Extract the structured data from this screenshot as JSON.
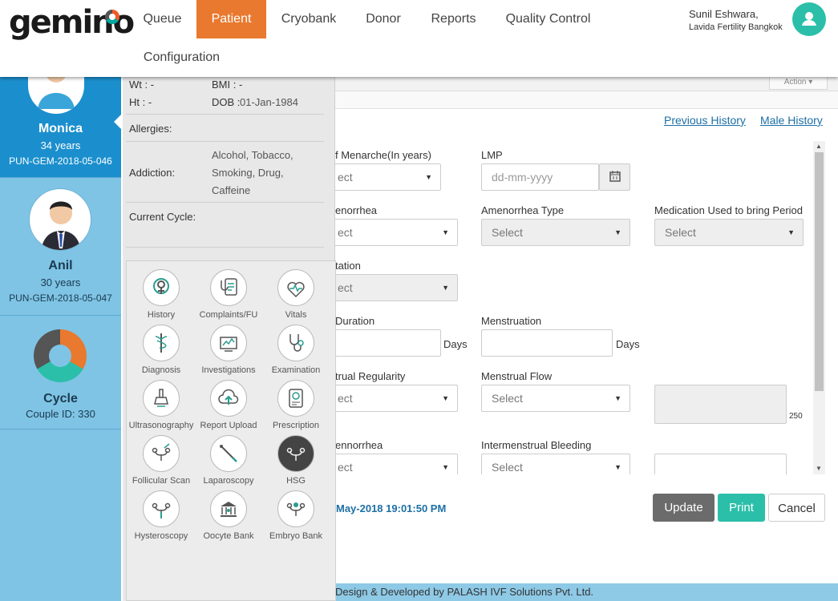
{
  "header": {
    "logo": "gemino",
    "nav": [
      "Queue",
      "Patient",
      "Cryobank",
      "Donor",
      "Reports",
      "Quality Control"
    ],
    "nav2": "Configuration",
    "active_nav": "Patient",
    "user_name": "Sunil Eshwara,",
    "user_org": "Lavida Fertility Bangkok"
  },
  "patients": [
    {
      "name": "Monica",
      "age": "34 years",
      "id": "PUN-GEM-2018-05-046"
    },
    {
      "name": "Anil",
      "age": "30 years",
      "id": "PUN-GEM-2018-05-047"
    }
  ],
  "cycle": {
    "title": "Cycle",
    "couple_id": "Couple ID: 330"
  },
  "info": {
    "wt_label": "Wt : -",
    "bmi_label": "BMI : -",
    "ht_label": "Ht : -",
    "dob_label": "DOB :",
    "dob_value": "01-Jan-1984",
    "allergies_label": "Allergies:",
    "addiction_label": "Addiction:",
    "addiction_lines": [
      "Alcohol, Tobacco,",
      "Smoking, Drug,",
      "Caffeine"
    ],
    "current_cycle_label": "Current Cycle:"
  },
  "modules": [
    {
      "label": "History",
      "icon": "history-icon"
    },
    {
      "label": "Complaints/FU",
      "icon": "complaints-icon"
    },
    {
      "label": "Vitals",
      "icon": "vitals-icon"
    },
    {
      "label": "Diagnosis",
      "icon": "diagnosis-icon"
    },
    {
      "label": "Investigations",
      "icon": "investigations-icon"
    },
    {
      "label": "Examination",
      "icon": "examination-icon"
    },
    {
      "label": "Ultrasonography",
      "icon": "ultrasonography-icon"
    },
    {
      "label": "Report Upload",
      "icon": "report-upload-icon"
    },
    {
      "label": "Prescription",
      "icon": "prescription-icon"
    },
    {
      "label": "Follicular Scan",
      "icon": "follicular-scan-icon"
    },
    {
      "label": "Laparoscopy",
      "icon": "laparoscopy-icon"
    },
    {
      "label": "HSG",
      "icon": "hsg-icon"
    },
    {
      "label": "Hysteroscopy",
      "icon": "hysteroscopy-icon"
    },
    {
      "label": "Oocyte Bank",
      "icon": "oocyte-bank-icon"
    },
    {
      "label": "Embryo Bank",
      "icon": "embryo-bank-icon"
    }
  ],
  "main": {
    "action_label": "Action",
    "previous_history": "Previous History",
    "male_history": "Male History",
    "form": {
      "menarche_label": "f Menarche(In years)",
      "menarche_value": "ect",
      "lmp_label": "LMP",
      "lmp_placeholder": "dd-mm-yyyy",
      "amenorrhea_label": "enorrhea",
      "amenorrhea_value": "ect",
      "amenorrhea_type_label": "Amenorrhea Type",
      "amenorrhea_type_value": "Select",
      "medication_label": "Medication Used to bring Period",
      "medication_value": "Select",
      "tation_label": "tation",
      "tation_value": "ect",
      "duration_label": "Duration",
      "days1": "Days",
      "menstruation_label": "Menstruation",
      "days2": "Days",
      "regularity_label": "trual Regularity",
      "regularity_value": "ect",
      "flow_label": "Menstrual Flow",
      "flow_value": "Select",
      "counter": "250",
      "ennorrhea_label": "ennorrhea",
      "ennorrhea_value": "ect",
      "intermenstrual_label": "Intermenstrual Bleeding",
      "intermenstrual_value": "Select"
    },
    "last_updated": "May-2018 19:01:50 PM",
    "update_btn": "Update",
    "print_btn": "Print",
    "cancel_btn": "Cancel",
    "footer": "Design & Developed by PALASH IVF Solutions Pvt. Ltd."
  },
  "colors": {
    "accent": "#e8792f",
    "teal": "#2bbfa9",
    "sidebar_active": "#1b8fcd",
    "sidebar": "#7fc4e5",
    "link": "#1d6fa5"
  }
}
